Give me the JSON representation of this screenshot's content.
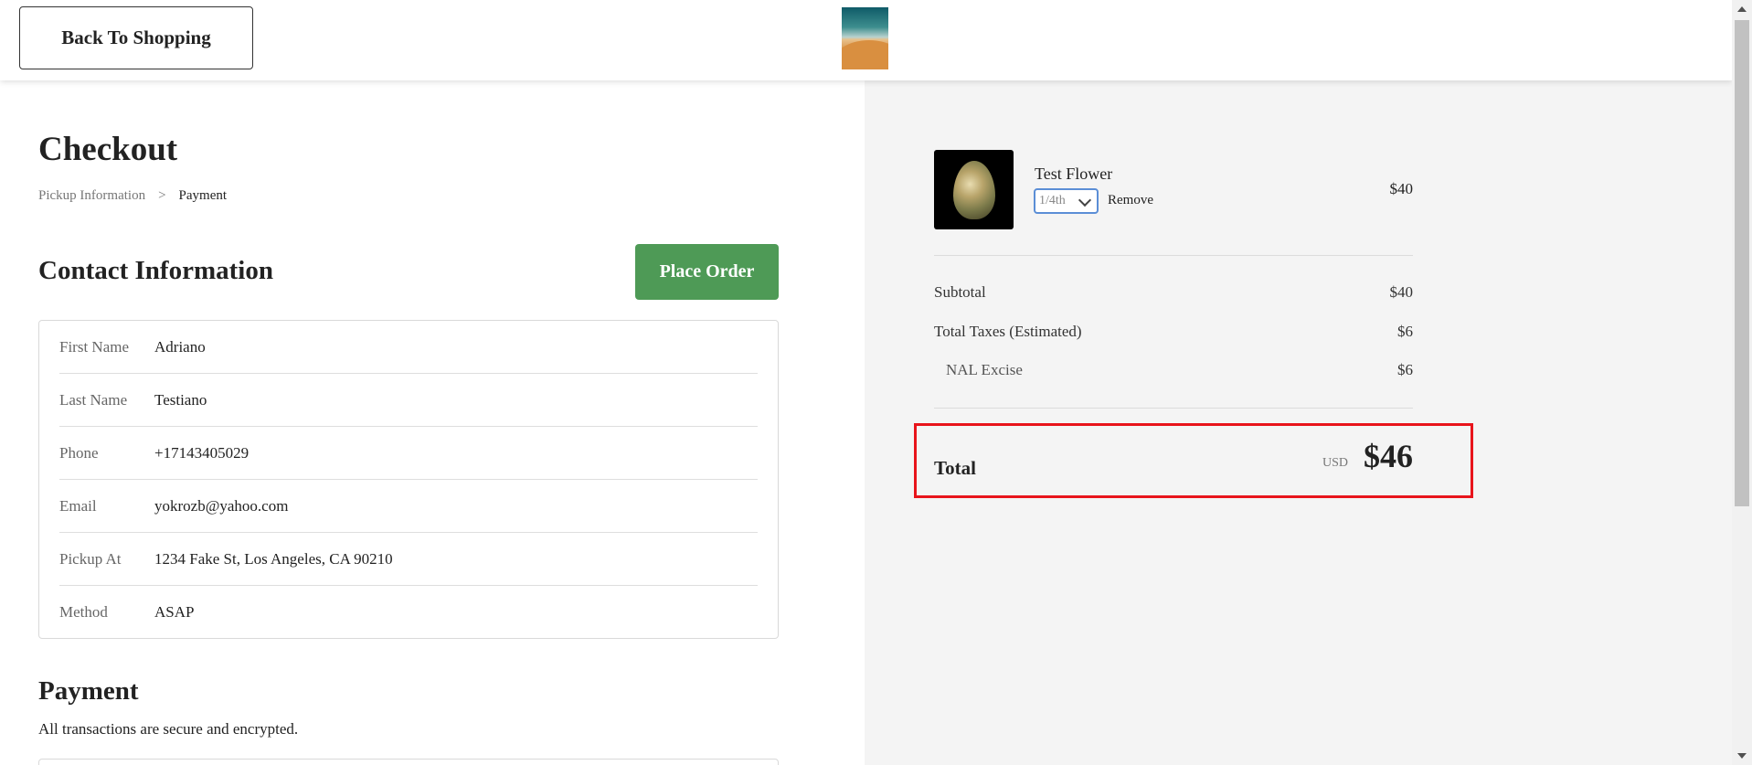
{
  "header": {
    "back_label": "Back To Shopping",
    "logo_icon": "desert-dune-logo-icon"
  },
  "checkout": {
    "title": "Checkout",
    "breadcrumb": {
      "step1": "Pickup Information",
      "separator": ">",
      "step2": "Payment"
    }
  },
  "contact": {
    "title": "Contact Information",
    "place_order_label": "Place Order",
    "rows": [
      {
        "label": "First Name",
        "value": "Adriano"
      },
      {
        "label": "Last Name",
        "value": "Testiano"
      },
      {
        "label": "Phone",
        "value": "+17143405029"
      },
      {
        "label": "Email",
        "value": "yokrozb@yahoo.com"
      },
      {
        "label": "Pickup At",
        "value": "1234 Fake St, Los Angeles, CA 90210"
      },
      {
        "label": "Method",
        "value": "ASAP"
      }
    ]
  },
  "payment": {
    "title": "Payment",
    "subtitle": "All transactions are secure and encrypted."
  },
  "cart": {
    "item": {
      "name": "Test Flower",
      "quantity": "1/4th",
      "remove_label": "Remove",
      "price": "$40"
    },
    "subtotal_label": "Subtotal",
    "subtotal_value": "$40",
    "taxes_label": "Total Taxes (Estimated)",
    "taxes_value": "$6",
    "excise_label": "NAL Excise",
    "excise_value": "$6",
    "total_label": "Total",
    "total_currency": "USD",
    "total_value": "$46"
  },
  "colors": {
    "place_order_bg": "#4e9a56",
    "highlight_border": "#e8141b",
    "select_border": "#5b8ed6",
    "summary_bg": "#f4f4f4"
  }
}
